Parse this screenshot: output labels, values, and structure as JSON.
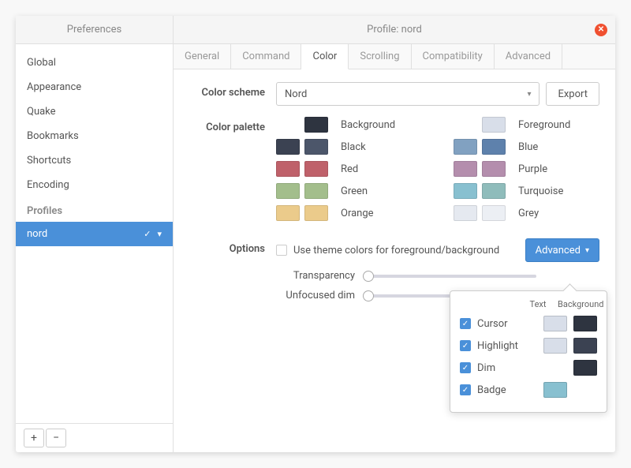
{
  "titlebar": {
    "left": "Preferences",
    "right": "Profile: nord"
  },
  "sidebar": {
    "items": [
      "Global",
      "Appearance",
      "Quake",
      "Bookmarks",
      "Shortcuts",
      "Encoding"
    ],
    "profiles_header": "Profiles",
    "profiles": [
      "nord"
    ],
    "add": "+",
    "remove": "−"
  },
  "tabs": [
    "General",
    "Command",
    "Color",
    "Scrolling",
    "Compatibility",
    "Advanced"
  ],
  "active_tab": "Color",
  "scheme": {
    "label": "Color scheme",
    "value": "Nord",
    "export": "Export"
  },
  "palette": {
    "label": "Color palette",
    "left": [
      {
        "label": "Background",
        "swatches": [
          "#2e3440"
        ]
      },
      {
        "label": "Black",
        "swatches": [
          "#3b4252",
          "#4c566a"
        ]
      },
      {
        "label": "Red",
        "swatches": [
          "#bf616a",
          "#bf616a"
        ]
      },
      {
        "label": "Green",
        "swatches": [
          "#a3be8c",
          "#a3be8c"
        ]
      },
      {
        "label": "Orange",
        "swatches": [
          "#ebcb8b",
          "#ebcb8b"
        ]
      }
    ],
    "right": [
      {
        "label": "Foreground",
        "swatches": [
          "#d8dee9"
        ]
      },
      {
        "label": "Blue",
        "swatches": [
          "#81a1c1",
          "#5e81ac"
        ]
      },
      {
        "label": "Purple",
        "swatches": [
          "#b48ead",
          "#b48ead"
        ]
      },
      {
        "label": "Turquoise",
        "swatches": [
          "#88c0d0",
          "#8fbcbb"
        ]
      },
      {
        "label": "Grey",
        "swatches": [
          "#e5e9f0",
          "#eceff4"
        ]
      }
    ]
  },
  "options": {
    "label": "Options",
    "theme_colors": "Use theme colors for foreground/background",
    "advanced": "Advanced",
    "sliders": [
      {
        "label": "Transparency"
      },
      {
        "label": "Unfocused dim"
      }
    ]
  },
  "popover": {
    "headers": [
      "Text",
      "Background"
    ],
    "rows": [
      {
        "label": "Cursor",
        "checked": true,
        "text": "#d8dee9",
        "bg": "#2e3440"
      },
      {
        "label": "Highlight",
        "checked": true,
        "text": "#d8dee9",
        "bg": "#3b4252"
      },
      {
        "label": "Dim",
        "checked": true,
        "text": null,
        "bg": "#2e3440"
      },
      {
        "label": "Badge",
        "checked": true,
        "text": "#88c0d0",
        "bg": null
      }
    ]
  }
}
